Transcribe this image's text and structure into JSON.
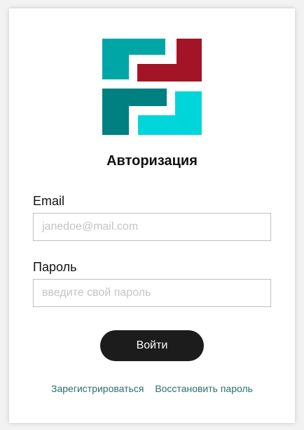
{
  "title": "Авторизация",
  "logo": {
    "name": "logo",
    "colors": {
      "teal": "#00a6a6",
      "crimson": "#a31426",
      "dark_teal": "#008080",
      "cyan": "#00d6d9"
    }
  },
  "form": {
    "email_label": "Email",
    "email_placeholder": "janedoe@mail.com",
    "password_label": "Пароль",
    "password_placeholder": "введите свой пароль",
    "submit_label": "Войти"
  },
  "links": {
    "register": "Зарегистрироваться",
    "restore": "Восстановить пароль"
  },
  "colors": {
    "button_bg": "#1c1c1c",
    "link": "#2a6f6b",
    "border": "#bdbdbd"
  }
}
